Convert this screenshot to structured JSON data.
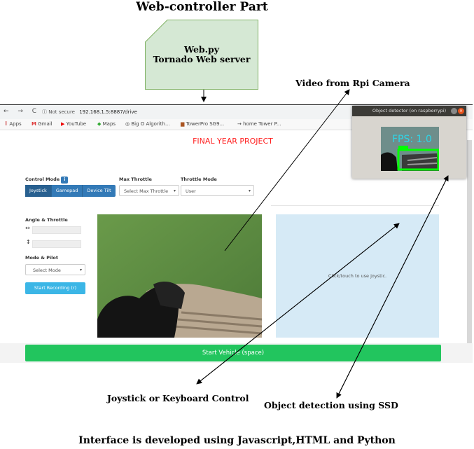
{
  "diagram": {
    "title": "Web-controller Part",
    "server_box": {
      "line1": "Web.py",
      "line2": "Tornado Web server",
      "fill": "#d5e8d4",
      "stroke": "#82b366"
    },
    "labels": {
      "video": "Video from Rpi Camera",
      "joystick": "Joystick or Keyboard Control",
      "object_detection": "Object detection using SSD"
    },
    "footer": "Interface is developed using Javascript,HTML and Python"
  },
  "browser": {
    "nav_icons": "← → C",
    "not_secure": "ⓘ Not secure",
    "url": "192.168.1.5:8887/drive",
    "bookmarks": [
      "Apps",
      "Gmail",
      "YouTube",
      "Maps",
      "Big O Algorith...",
      "TowerPro SG9...",
      "home Tower P..."
    ],
    "page_title": "FINAL YEAR PROJECT",
    "control_mode": {
      "label": "Control Mode",
      "options": [
        "Joystick",
        "Gamepad",
        "Device Tilt"
      ],
      "active": "Joystick"
    },
    "max_throttle": {
      "label": "Max Throttle",
      "value": "Select Max Throttle"
    },
    "throttle_mode": {
      "label": "Throttle Mode",
      "value": "User"
    },
    "angle_throttle_label": "Angle & Throttle",
    "angle_symbol": "↔",
    "throttle_symbol": "↕",
    "mode_pilot": {
      "label": "Mode & Pilot",
      "value": "Select Mode"
    },
    "record_button": "Start Recording (r)",
    "touchpad_text": "Click/touch to use joystic.",
    "start_button": "Start Vehicle (space)"
  },
  "detector": {
    "window_title": "Object detector (on raspberrypi)",
    "fps_text": "FPS: 1.0",
    "close_glyph": "×"
  },
  "colors": {
    "accent_red": "#ff1e1e",
    "start_green": "#22c55e",
    "primary_blue": "#337ab7",
    "box_green": "#00ff00"
  }
}
